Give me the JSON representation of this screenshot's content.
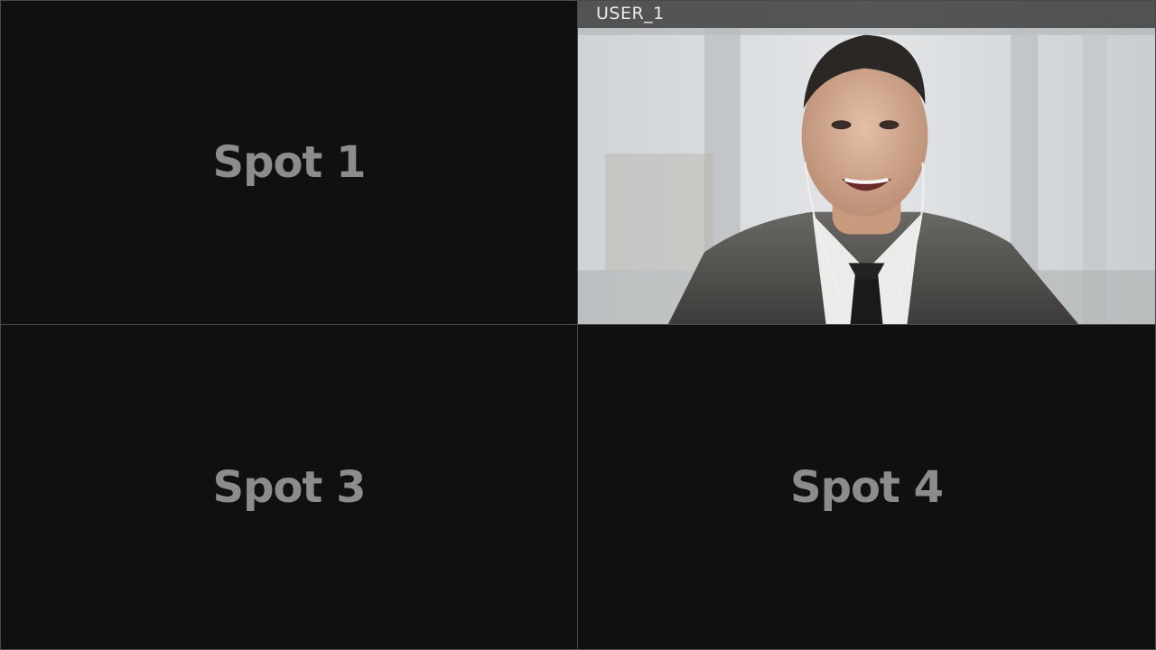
{
  "tiles": [
    {
      "id": "spot-1",
      "label": "Spot 1"
    },
    {
      "id": "spot-2",
      "participant": "USER_1"
    },
    {
      "id": "spot-3",
      "label": "Spot 3"
    },
    {
      "id": "spot-4",
      "label": "Spot 4"
    }
  ],
  "colors": {
    "tile_background": "#101010",
    "grid_border": "#4a4a4a",
    "spot_label": "#8c8c8c",
    "name_bar": "#3c3c3c",
    "name_text": "#eaeaea"
  }
}
